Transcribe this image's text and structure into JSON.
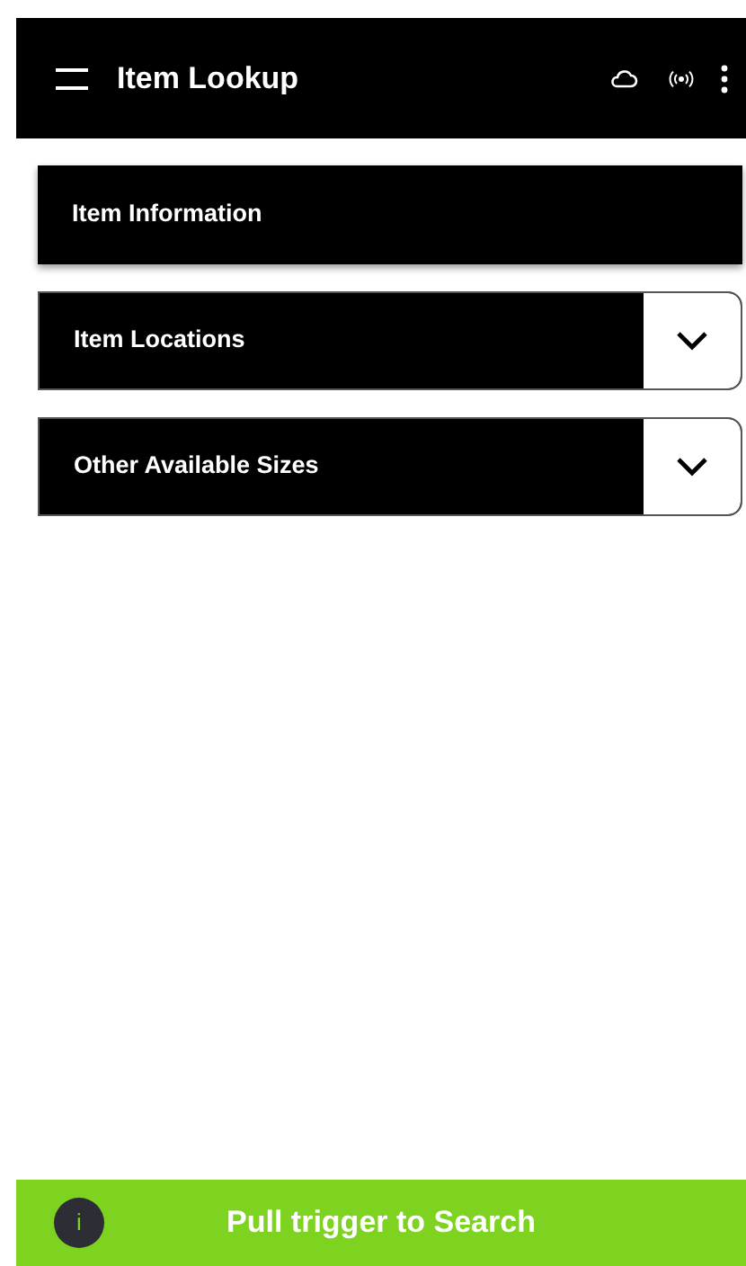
{
  "app_bar": {
    "title": "Item Lookup"
  },
  "sections": [
    {
      "title": "Item Information",
      "expandable": false
    },
    {
      "title": "Item Locations",
      "expandable": true
    },
    {
      "title": "Other Available Sizes",
      "expandable": true
    }
  ],
  "bottom_bar": {
    "info_glyph": "i",
    "label": "Pull trigger to Search"
  }
}
